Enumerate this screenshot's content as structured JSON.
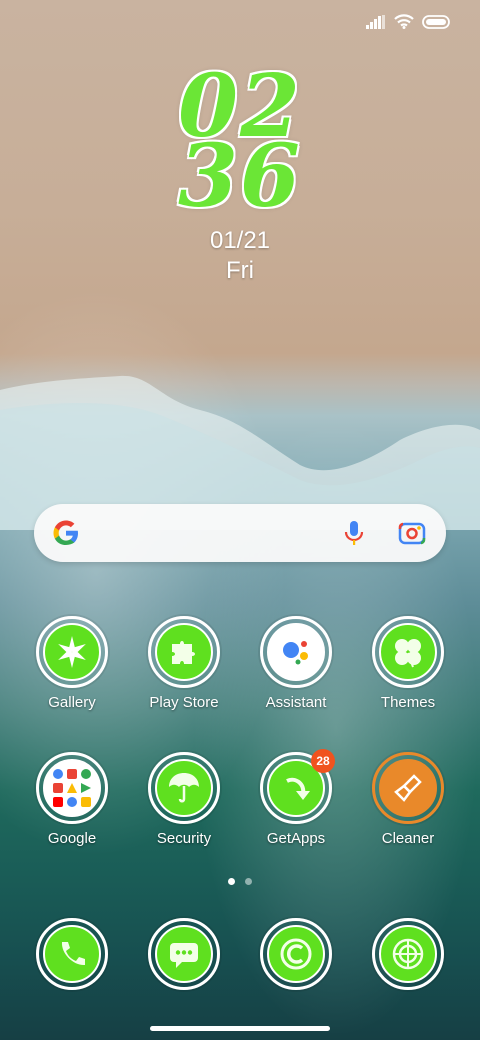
{
  "clock": {
    "hour": "02",
    "minute": "36"
  },
  "date": {
    "day_month": "01/21",
    "weekday": "Fri"
  },
  "search": {
    "placeholder": ""
  },
  "apps_row1": [
    {
      "label": "Gallery"
    },
    {
      "label": "Play Store"
    },
    {
      "label": "Assistant"
    },
    {
      "label": "Themes"
    }
  ],
  "apps_row2": [
    {
      "label": "Google"
    },
    {
      "label": "Security"
    },
    {
      "label": "GetApps",
      "badge": "28"
    },
    {
      "label": "Cleaner"
    }
  ],
  "dock": [
    {
      "icon": "phone-icon"
    },
    {
      "icon": "messages-icon"
    },
    {
      "icon": "browser-icon"
    },
    {
      "icon": "camera-icon"
    }
  ],
  "colors": {
    "icon_green": "#5fe01f",
    "badge": "#f0531e",
    "cleaner": "#e9892a"
  }
}
